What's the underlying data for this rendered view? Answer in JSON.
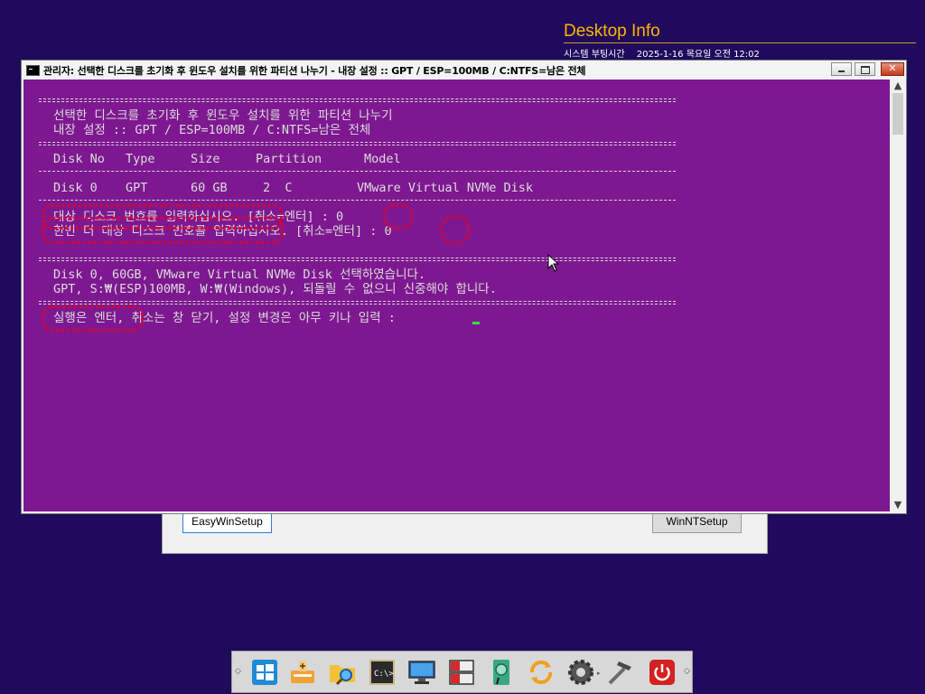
{
  "desktop_info": {
    "title": "Desktop Info",
    "label": "시스템 부팅시간",
    "datetime": "2025-1-16 목요일 오전 12:02"
  },
  "background_app": {
    "left_button": "EasyWinSetup",
    "right_button": "WinNTSetup"
  },
  "window": {
    "title": "관리자: 선택한 디스크를 초기화 후 윈도우 설치를 위한 파티션 나누기 - 내장 설정 :: GPT / ESP=100MB / C:NTFS=남은 전체"
  },
  "console": {
    "header1": "선택한 디스크를 초기화 후 윈도우 설치를 위한 파티션 나누기",
    "header2": "내장 설정 :: GPT / ESP=100MB / C:NTFS=남은 전체",
    "columns": [
      "Disk No",
      "Type",
      "Size",
      "Partition",
      "Model"
    ],
    "row": [
      "Disk 0",
      "GPT",
      "60 GB",
      "2  C",
      "VMware Virtual NVMe Disk"
    ],
    "prompt1": "대상 디스크 번호를 입력하십시오. [취소=엔터] : 0",
    "prompt2": "한번 더 대상 디스크 번호를 입력하십시오. [취소=엔터] : 0",
    "info1": "Disk 0, 60GB, VMware Virtual NVMe Disk 선택하였습니다.",
    "info2": "GPT, S:₩(ESP)100MB, W:₩(Windows), 되돌릴 수 없으니 신중해야 합니다.",
    "final_prompt": "실행은 엔터, 취소는 창 닫기, 설정 변경은 아무 키나 입력 :"
  },
  "colors": {
    "desktop": "#1f0a5c",
    "console_bg": "#7e1891",
    "console_text": "#dcdcdc",
    "highlight": "#e0002a",
    "cursor": "#2fe04a",
    "desktop_info_title": "#ffb400"
  },
  "taskbar_icons": [
    "windows-start-icon",
    "usb-drive-icon",
    "folder-search-icon",
    "cmd-terminal-icon",
    "monitor-icon",
    "disk-manager-icon",
    "hdd-tool-icon",
    "sync-refresh-icon",
    "settings-gear-icon",
    "hammer-tools-icon",
    "power-icon"
  ]
}
